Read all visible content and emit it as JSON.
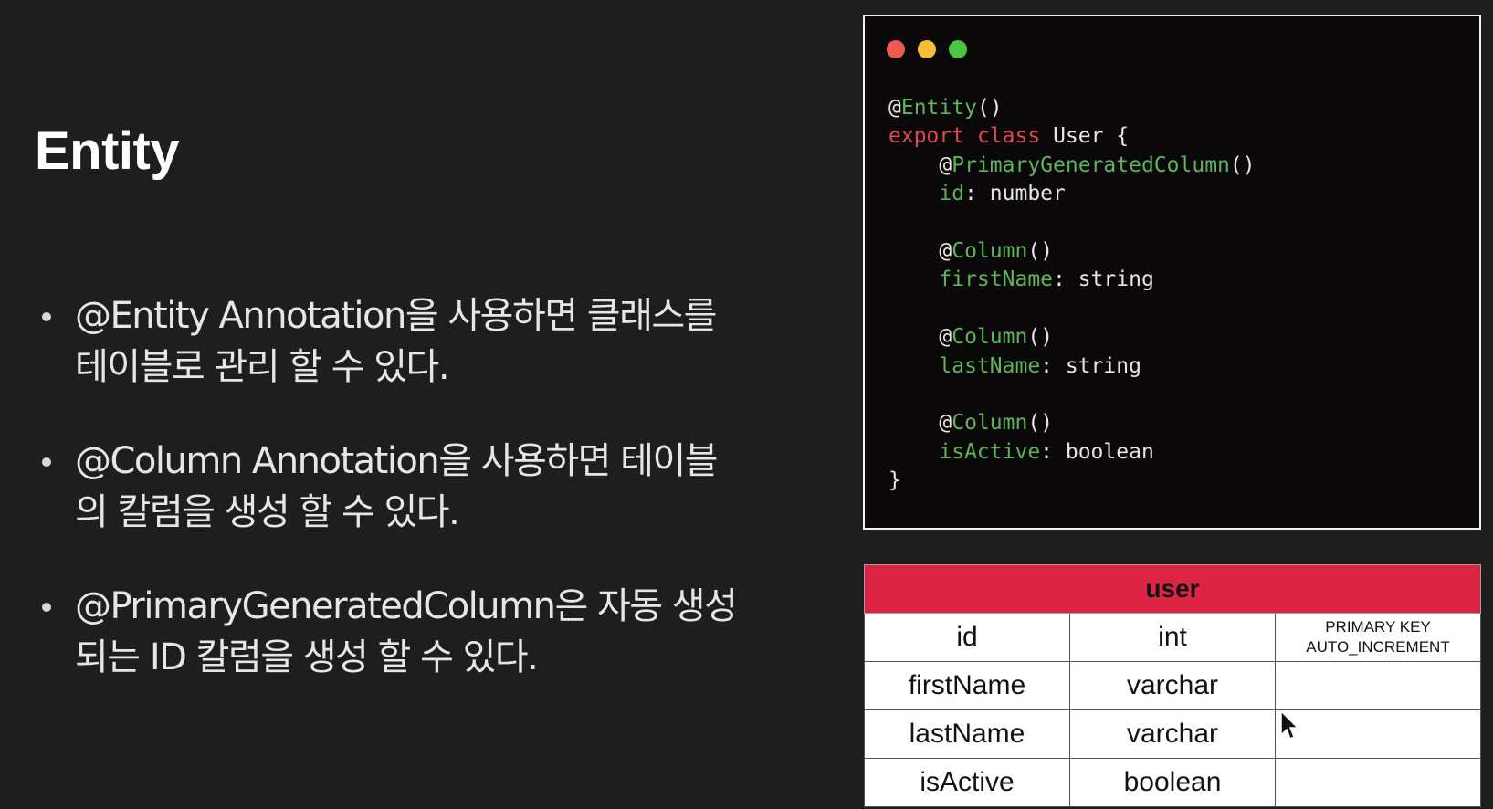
{
  "slide": {
    "title": "Entity",
    "bullets": [
      {
        "line1": "@Entity Annotation을 사용하면 클래스를",
        "line2": "테이블로 관리 할 수 있다."
      },
      {
        "line1": "@Column Annotation을 사용하면 테이블",
        "line2": "의 칼럼을 생성 할 수 있다."
      },
      {
        "line1": "@PrimaryGeneratedColumn은 자동 생성",
        "line2": "되는 ID 칼럼을 생성 할 수 있다."
      }
    ]
  },
  "code": {
    "decorator_at": "@",
    "entity_decorator": "Entity",
    "parens": "()",
    "kw_export": "export",
    "kw_class": "class",
    "class_name": "User {",
    "pk_decorator": "PrimaryGeneratedColumn",
    "col_decorator": "Column",
    "fields": [
      {
        "name": "id",
        "type": ": number"
      },
      {
        "name": "firstName",
        "type": ": string"
      },
      {
        "name": "lastName",
        "type": ": string"
      },
      {
        "name": "isActive",
        "type": ": boolean"
      }
    ],
    "close_brace": "}"
  },
  "table": {
    "name": "user",
    "rows": [
      {
        "column": "id",
        "type": "int",
        "constraint1": "PRIMARY KEY",
        "constraint2": "AUTO_INCREMENT"
      },
      {
        "column": "firstName",
        "type": "varchar",
        "constraint1": "",
        "constraint2": ""
      },
      {
        "column": "lastName",
        "type": "varchar",
        "constraint1": "",
        "constraint2": ""
      },
      {
        "column": "isActive",
        "type": "boolean",
        "constraint1": "",
        "constraint2": ""
      }
    ]
  },
  "colors": {
    "background": "#1e1e1e",
    "code_background": "#0a0808",
    "decorator_green": "#5fb35a",
    "keyword_red": "#e0484f",
    "table_header": "#dd2444",
    "traffic_red": "#ee5a52",
    "traffic_yellow": "#f4bd3a",
    "traffic_green": "#4cc544"
  }
}
